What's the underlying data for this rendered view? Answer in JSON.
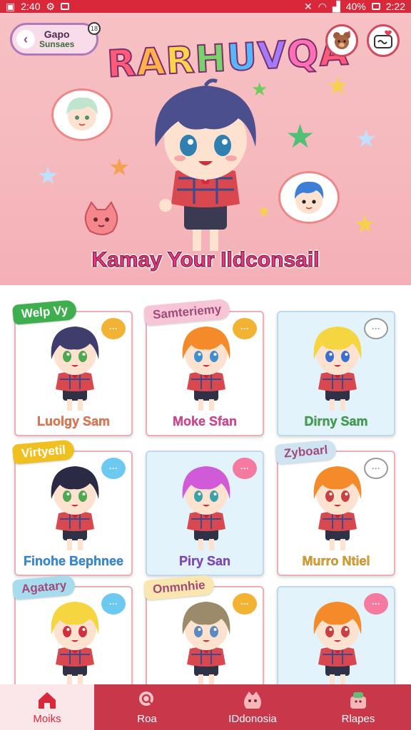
{
  "status_bar": {
    "time": "2:40",
    "battery": "40%",
    "clock_right": "2:22"
  },
  "header": {
    "back_button": {
      "line1": "Gapo",
      "line2": "Sunsaes",
      "badge": "18"
    },
    "title_letters": [
      "R",
      "A",
      "R",
      "H",
      "U",
      "V",
      "Q",
      "A"
    ],
    "subtitle": "Kamay Your Ildconsail"
  },
  "cards": [
    {
      "tag": "Welp Vy",
      "tag_color": "#3fae4f",
      "name": "Luolgy Sam",
      "name_color": "#f0784a",
      "bg": "white",
      "hair": "#3e3d6b",
      "eyes": "#4fa84f",
      "chat_color": "#f2b233"
    },
    {
      "tag": "Samteriemy",
      "tag_color": "#f6c6d7",
      "name": "Moke Sfan",
      "name_color": "#e0439a",
      "bg": "white",
      "hair": "#f58a2a",
      "eyes": "#3f8fd0",
      "chat_color": "#f2b233"
    },
    {
      "tag": "",
      "tag_color": "",
      "name": "Dirny Sam",
      "name_color": "#3aa648",
      "bg": "blue",
      "hair": "#f6d640",
      "eyes": "#3b6fd0",
      "chat_color": "#ffffff"
    },
    {
      "tag": "Virtyetil",
      "tag_color": "#f0c021",
      "name": "Finohe Bephnee",
      "name_color": "#2f8fe0",
      "bg": "white",
      "hair": "#2b2a44",
      "eyes": "#4fa84f",
      "chat_color": "#6ccaf0"
    },
    {
      "tag": "",
      "tag_color": "",
      "name": "Piry San",
      "name_color": "#8a46c8",
      "bg": "blue",
      "hair": "#d05ad8",
      "eyes": "#3aa1a8",
      "chat_color": "#f47aa0"
    },
    {
      "tag": "Zyboarl",
      "tag_color": "#cfe4f2",
      "name": "Murro Ntiel",
      "name_color": "#e0a21a",
      "bg": "white",
      "hair": "#f58a2a",
      "eyes": "#c94040",
      "chat_color": "#ffffff"
    },
    {
      "tag": "Agatary",
      "tag_color": "#a7dcef",
      "name": "",
      "name_color": "#d02a60",
      "bg": "white",
      "hair": "#f6d640",
      "eyes": "#d03040",
      "chat_color": "#6ccaf0"
    },
    {
      "tag": "Onmnhie",
      "tag_color": "#fae7b0",
      "name": "",
      "name_color": "#d02a60",
      "bg": "white",
      "hair": "#9b8b6a",
      "eyes": "#5a8ac0",
      "chat_color": "#f2b233"
    },
    {
      "tag": "",
      "tag_color": "",
      "name": "",
      "name_color": "#d02a60",
      "bg": "blue",
      "hair": "#f58a2a",
      "eyes": "#c94040",
      "chat_color": "#f47aa0"
    }
  ],
  "bottom_nav": [
    {
      "label": "Moiks",
      "icon": "home-icon",
      "active": true
    },
    {
      "label": "Roa",
      "icon": "chat-search-icon",
      "active": false
    },
    {
      "label": "IDdonosia",
      "icon": "mascot-icon",
      "active": false
    },
    {
      "label": "Rlapes",
      "icon": "gift-box-icon",
      "active": false
    }
  ],
  "colors": {
    "accent": "#d8283a",
    "nav_bg": "#c9374a",
    "hero_bg": "#f5b8bd"
  }
}
